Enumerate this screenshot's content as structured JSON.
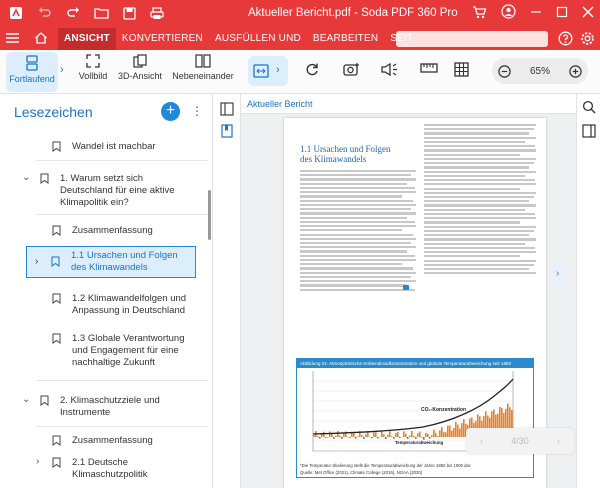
{
  "window": {
    "title": "Aktueller Bericht.pdf  -  Soda PDF 360 Pro"
  },
  "tabs": [
    "ANSICHT",
    "KONVERTIEREN",
    "AUSFÜLLEN UND",
    "BEARBEITEN",
    "SEIT"
  ],
  "toolbar": {
    "fortlaufend": "Fortlaufend",
    "vollbild": "Vollbild",
    "ansicht3d": "3D-Ansicht",
    "nebeneinander": "Nebeneinander",
    "zoom": "65%"
  },
  "bookmarks": {
    "title": "Lesezeichen",
    "items": [
      {
        "label": "Wandel ist machbar",
        "label2": ""
      },
      {
        "label": "1. Warum setzt sich",
        "label2": "Deutschland für eine aktive",
        "label3": "Klimapolitik ein?"
      },
      {
        "label": "Zusammenfassung",
        "label2": ""
      },
      {
        "label": "1.1 Ursachen und Folgen",
        "label2": "des Klimawandels"
      },
      {
        "label": "1.2 Klimawandelfolgen und",
        "label2": "Anpassung in Deutschland"
      },
      {
        "label": "1.3 Globale Verantwortung",
        "label2": "und Engagement für eine",
        "label3": "nachhaltige Zukunft"
      },
      {
        "label": "2. Klimaschutzziele und",
        "label2": "Instrumente"
      },
      {
        "label": "Zusammenfassung",
        "label2": ""
      },
      {
        "label": "2.1 Deutsche",
        "label2": "Klimaschutzpolitik"
      }
    ]
  },
  "document": {
    "tab": "Aktueller Bericht",
    "heading1": "1.1  Ursachen und Folgen",
    "heading2": "des Klimawandels",
    "figure_title": "Abbildung 01: Atmosphärische Kohlendioxidkonzentration und globale Temperaturabweichung seit 1850",
    "co2_label": "CO₂-Konzentration",
    "temp_label": "Temperaturabweichung",
    "temp_sub": "gegenüber dem Temperaturdurchschnitt der Jahre 1850 bis 1900",
    "foot1": "*Die Temperatur-Skalierung stellt die Temperaturabweichung der Jahre 1850 bis 1900 dar.",
    "foot2": "Quelle: Met Office (2021), Climate College (2016), NOAA (2020)"
  },
  "pager": {
    "page": "4/30"
  },
  "colors": {
    "brand": "#e8393a",
    "accent": "#1e88d9"
  }
}
